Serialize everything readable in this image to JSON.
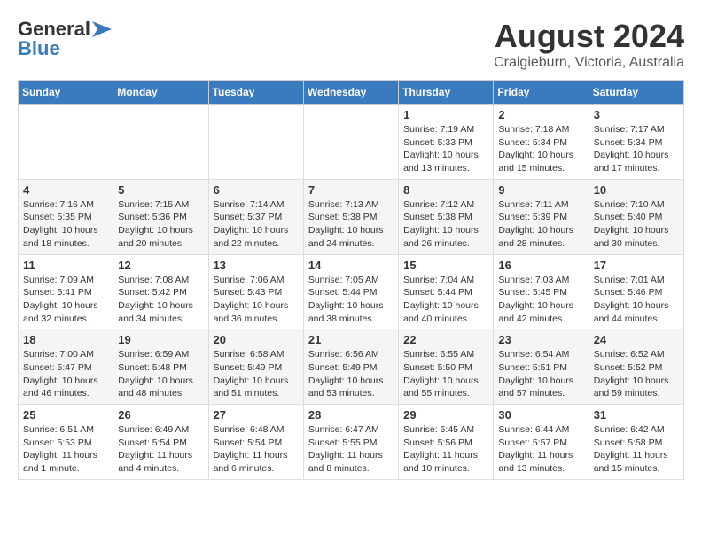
{
  "header": {
    "logo_line1": "General",
    "logo_line2": "Blue",
    "month_year": "August 2024",
    "location": "Craigieburn, Victoria, Australia"
  },
  "weekdays": [
    "Sunday",
    "Monday",
    "Tuesday",
    "Wednesday",
    "Thursday",
    "Friday",
    "Saturday"
  ],
  "weeks": [
    [
      {
        "day": "",
        "info": ""
      },
      {
        "day": "",
        "info": ""
      },
      {
        "day": "",
        "info": ""
      },
      {
        "day": "",
        "info": ""
      },
      {
        "day": "1",
        "info": "Sunrise: 7:19 AM\nSunset: 5:33 PM\nDaylight: 10 hours\nand 13 minutes."
      },
      {
        "day": "2",
        "info": "Sunrise: 7:18 AM\nSunset: 5:34 PM\nDaylight: 10 hours\nand 15 minutes."
      },
      {
        "day": "3",
        "info": "Sunrise: 7:17 AM\nSunset: 5:34 PM\nDaylight: 10 hours\nand 17 minutes."
      }
    ],
    [
      {
        "day": "4",
        "info": "Sunrise: 7:16 AM\nSunset: 5:35 PM\nDaylight: 10 hours\nand 18 minutes."
      },
      {
        "day": "5",
        "info": "Sunrise: 7:15 AM\nSunset: 5:36 PM\nDaylight: 10 hours\nand 20 minutes."
      },
      {
        "day": "6",
        "info": "Sunrise: 7:14 AM\nSunset: 5:37 PM\nDaylight: 10 hours\nand 22 minutes."
      },
      {
        "day": "7",
        "info": "Sunrise: 7:13 AM\nSunset: 5:38 PM\nDaylight: 10 hours\nand 24 minutes."
      },
      {
        "day": "8",
        "info": "Sunrise: 7:12 AM\nSunset: 5:38 PM\nDaylight: 10 hours\nand 26 minutes."
      },
      {
        "day": "9",
        "info": "Sunrise: 7:11 AM\nSunset: 5:39 PM\nDaylight: 10 hours\nand 28 minutes."
      },
      {
        "day": "10",
        "info": "Sunrise: 7:10 AM\nSunset: 5:40 PM\nDaylight: 10 hours\nand 30 minutes."
      }
    ],
    [
      {
        "day": "11",
        "info": "Sunrise: 7:09 AM\nSunset: 5:41 PM\nDaylight: 10 hours\nand 32 minutes."
      },
      {
        "day": "12",
        "info": "Sunrise: 7:08 AM\nSunset: 5:42 PM\nDaylight: 10 hours\nand 34 minutes."
      },
      {
        "day": "13",
        "info": "Sunrise: 7:06 AM\nSunset: 5:43 PM\nDaylight: 10 hours\nand 36 minutes."
      },
      {
        "day": "14",
        "info": "Sunrise: 7:05 AM\nSunset: 5:44 PM\nDaylight: 10 hours\nand 38 minutes."
      },
      {
        "day": "15",
        "info": "Sunrise: 7:04 AM\nSunset: 5:44 PM\nDaylight: 10 hours\nand 40 minutes."
      },
      {
        "day": "16",
        "info": "Sunrise: 7:03 AM\nSunset: 5:45 PM\nDaylight: 10 hours\nand 42 minutes."
      },
      {
        "day": "17",
        "info": "Sunrise: 7:01 AM\nSunset: 5:46 PM\nDaylight: 10 hours\nand 44 minutes."
      }
    ],
    [
      {
        "day": "18",
        "info": "Sunrise: 7:00 AM\nSunset: 5:47 PM\nDaylight: 10 hours\nand 46 minutes."
      },
      {
        "day": "19",
        "info": "Sunrise: 6:59 AM\nSunset: 5:48 PM\nDaylight: 10 hours\nand 48 minutes."
      },
      {
        "day": "20",
        "info": "Sunrise: 6:58 AM\nSunset: 5:49 PM\nDaylight: 10 hours\nand 51 minutes."
      },
      {
        "day": "21",
        "info": "Sunrise: 6:56 AM\nSunset: 5:49 PM\nDaylight: 10 hours\nand 53 minutes."
      },
      {
        "day": "22",
        "info": "Sunrise: 6:55 AM\nSunset: 5:50 PM\nDaylight: 10 hours\nand 55 minutes."
      },
      {
        "day": "23",
        "info": "Sunrise: 6:54 AM\nSunset: 5:51 PM\nDaylight: 10 hours\nand 57 minutes."
      },
      {
        "day": "24",
        "info": "Sunrise: 6:52 AM\nSunset: 5:52 PM\nDaylight: 10 hours\nand 59 minutes."
      }
    ],
    [
      {
        "day": "25",
        "info": "Sunrise: 6:51 AM\nSunset: 5:53 PM\nDaylight: 11 hours\nand 1 minute."
      },
      {
        "day": "26",
        "info": "Sunrise: 6:49 AM\nSunset: 5:54 PM\nDaylight: 11 hours\nand 4 minutes."
      },
      {
        "day": "27",
        "info": "Sunrise: 6:48 AM\nSunset: 5:54 PM\nDaylight: 11 hours\nand 6 minutes."
      },
      {
        "day": "28",
        "info": "Sunrise: 6:47 AM\nSunset: 5:55 PM\nDaylight: 11 hours\nand 8 minutes."
      },
      {
        "day": "29",
        "info": "Sunrise: 6:45 AM\nSunset: 5:56 PM\nDaylight: 11 hours\nand 10 minutes."
      },
      {
        "day": "30",
        "info": "Sunrise: 6:44 AM\nSunset: 5:57 PM\nDaylight: 11 hours\nand 13 minutes."
      },
      {
        "day": "31",
        "info": "Sunrise: 6:42 AM\nSunset: 5:58 PM\nDaylight: 11 hours\nand 15 minutes."
      }
    ]
  ]
}
